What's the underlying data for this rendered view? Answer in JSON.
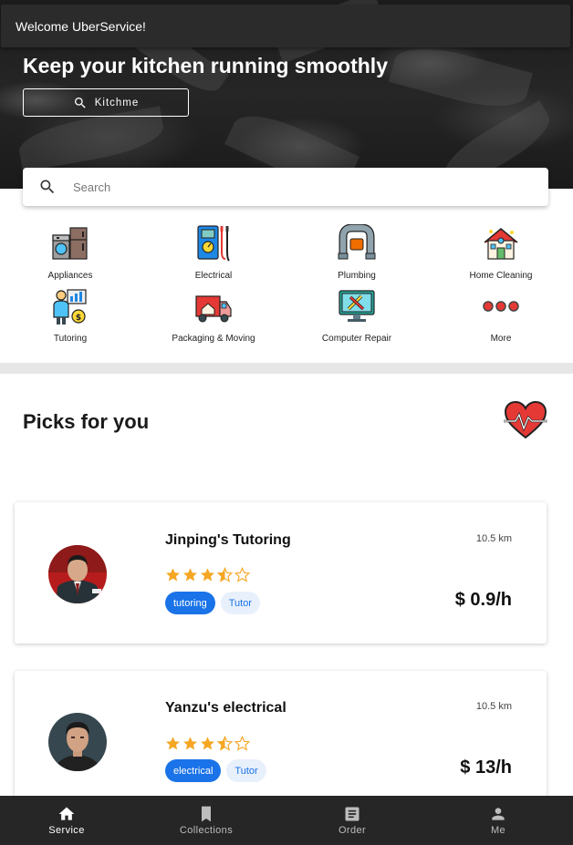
{
  "appbar": {
    "title": "Welcome UberService!"
  },
  "hero": {
    "title": "Keep your kitchen running smoothly",
    "button_label": "Kitchme",
    "button_icon": "search-icon"
  },
  "search": {
    "placeholder": "Search",
    "icon": "search-icon"
  },
  "categories": [
    {
      "label": "Appliances",
      "icon": "appliances-icon"
    },
    {
      "label": "Electrical",
      "icon": "multimeter-icon"
    },
    {
      "label": "Plumbing",
      "icon": "pipe-icon"
    },
    {
      "label": "Home Cleaning",
      "icon": "house-icon"
    },
    {
      "label": "Tutoring",
      "icon": "tutor-icon"
    },
    {
      "label": "Packaging & Moving",
      "icon": "truck-icon"
    },
    {
      "label": "Computer Repair",
      "icon": "computer-repair-icon"
    },
    {
      "label": "More",
      "icon": "more-icon"
    }
  ],
  "picks": {
    "title": "Picks for you",
    "icon": "heart-rate-icon",
    "cards": [
      {
        "name": "Jinping's Tutoring",
        "distance": "10.5 km",
        "rating": 3.5,
        "tags": [
          "tutoring",
          "Tutor"
        ],
        "price": "$ 0.9/h"
      },
      {
        "name": "Yanzu's electrical",
        "distance": "10.5 km",
        "rating": 3.5,
        "tags": [
          "electrical",
          "Tutor"
        ],
        "price": "$ 13/h"
      }
    ]
  },
  "bottom_nav": [
    {
      "label": "Service",
      "icon": "home-icon",
      "active": true
    },
    {
      "label": "Collections",
      "icon": "bookmark-icon",
      "active": false
    },
    {
      "label": "Order",
      "icon": "order-icon",
      "active": false
    },
    {
      "label": "Me",
      "icon": "person-icon",
      "active": false
    }
  ],
  "colors": {
    "accent": "#1a73e8",
    "star": "#f5a623",
    "nav_bg": "#262626"
  }
}
